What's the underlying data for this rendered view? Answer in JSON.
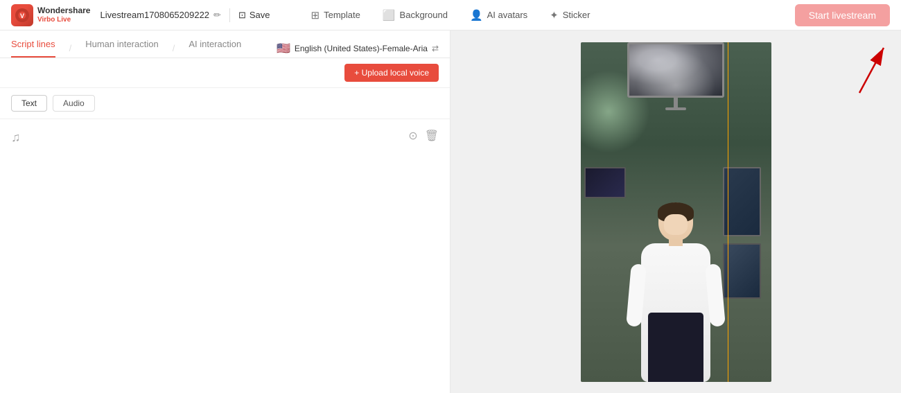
{
  "brand": {
    "name": "Wondershare",
    "sub": "Virbo Live",
    "logo_char": "V"
  },
  "header": {
    "session_name": "Livestream1708065209222",
    "save_label": "Save",
    "edit_icon": "✏",
    "save_icon": "⊡"
  },
  "nav": {
    "template_label": "Template",
    "background_label": "Background",
    "ai_avatars_label": "AI avatars",
    "sticker_label": "Sticker"
  },
  "start_btn_label": "Start livestream",
  "left_panel": {
    "tabs": [
      {
        "id": "script-lines",
        "label": "Script lines",
        "active": true
      },
      {
        "id": "human-interaction",
        "label": "Human interaction",
        "active": false
      },
      {
        "id": "ai-interaction",
        "label": "AI interaction",
        "active": false
      }
    ],
    "tab_divider": "/",
    "voice": {
      "flag": "🇺🇸",
      "name": "English (United States)-Female-Aria",
      "swap_icon": "⇄"
    },
    "upload_btn_label": "+ Upload local voice",
    "text_tab_label": "Text",
    "audio_tab_label": "Audio",
    "music_icon": "♫",
    "play_icon": "⊙",
    "delete_icon": "🗑"
  },
  "arrow": {
    "color": "#cc0000"
  }
}
